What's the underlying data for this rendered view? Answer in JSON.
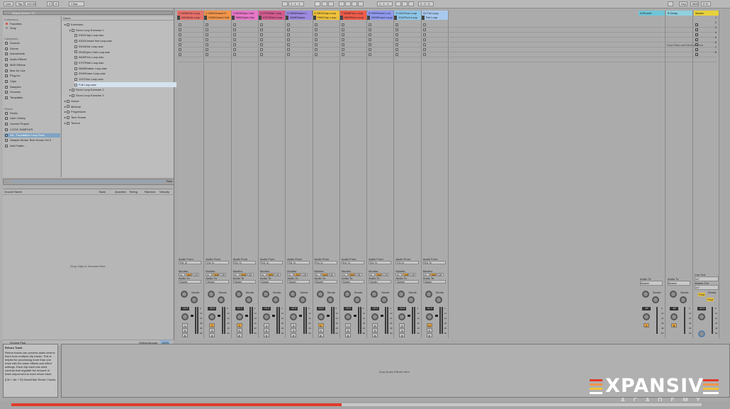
{
  "topbar": {
    "link": "Link",
    "tap": "Tap",
    "tempo": "120.00",
    "sig_num": "4",
    "sig_den": "4",
    "quantize": "1 Bar",
    "position": "1 . 1 . 1",
    "loop_start": "1 . 1 . 1",
    "loop_length": "4 . 0 . 0",
    "key": "Key",
    "midi": "MIDI",
    "cpu": "0 %"
  },
  "browser": {
    "search_placeholder": "Search (Cmd + F)",
    "collections_header": "Collections",
    "categories_header": "Categories",
    "places_header": "Places",
    "collections": [
      {
        "label": "Favorites",
        "color": "#d84a3a"
      },
      {
        "label": "Gray",
        "color": "#888888"
      }
    ],
    "categories": [
      "Sounds",
      "Drums",
      "Instruments",
      "Audio Effects",
      "MIDI Effects",
      "Max for Live",
      "Plug-ins",
      "Clips",
      "Samples",
      "Grooves",
      "Templates"
    ],
    "places": [
      "Packs",
      "User Library",
      "Current Project",
      "LOGIC SAMPLES",
      "XA - Foundation Loop Pack",
      "Sample Works Tech House Vol.3",
      "Add Folder..."
    ],
    "selected_place": "XA - Foundation Loop Pack",
    "name_header": "Name",
    "files": [
      {
        "label": "Exercises",
        "level": 0,
        "type": "folder"
      },
      {
        "label": "Drum Loop Exercise 1",
        "level": 1,
        "type": "folder"
      },
      {
        "label": "0302Clap Loop.wav",
        "level": 2,
        "type": "file"
      },
      {
        "label": "0303Closed Hat Loop.wav",
        "level": 2,
        "type": "file"
      },
      {
        "label": "0404Kick Loop.wav",
        "level": 2,
        "type": "file"
      },
      {
        "label": "0505Open Hat Loop.wav",
        "level": 2,
        "type": "file"
      },
      {
        "label": "0606Perc Loop.wav",
        "level": 2,
        "type": "file"
      },
      {
        "label": "0707Ride Loop.wav",
        "level": 2,
        "type": "file"
      },
      {
        "label": "0808Shaker Loop.wav",
        "level": 2,
        "type": "file"
      },
      {
        "label": "0909Snare Loop.wav",
        "level": 2,
        "type": "file"
      },
      {
        "label": "1010Tom Loop.wav",
        "level": 2,
        "type": "file"
      },
      {
        "label": "Full Loop.wav",
        "level": 2,
        "type": "file"
      },
      {
        "label": "Drum Loop Exercise 2",
        "level": 1,
        "type": "folder"
      },
      {
        "label": "Drum Loop Exercise 3",
        "level": 1,
        "type": "folder"
      },
      {
        "label": "House",
        "level": 0,
        "type": "folder"
      },
      {
        "label": "Minimal",
        "level": 0,
        "type": "folder"
      },
      {
        "label": "Progressive",
        "level": 0,
        "type": "folder"
      },
      {
        "label": "Tech House",
        "level": 0,
        "type": "folder"
      },
      {
        "label": "Techno",
        "level": 0,
        "type": "folder"
      }
    ],
    "selected_file": "Full Loop.wav",
    "raw_label": "Raw"
  },
  "groove": {
    "headers": [
      "Groove Name",
      "Base",
      "Quantize",
      "Timing",
      "Random",
      "Velocity"
    ],
    "drop_text": "Drop Clips or Grooves Here",
    "pool_label": "Groove Pool",
    "global_amount_label": "Global Amount",
    "global_amount_value": "100%"
  },
  "tracks": [
    {
      "name": "1 0404Kick Loop",
      "clip": "0404Kick Loop",
      "color": "#e8706a",
      "num": "1",
      "vol": "-14.3"
    },
    {
      "name": "2 0303Closed H",
      "clip": "0303Closed Hat",
      "color": "#f2954a",
      "num": "2",
      "vol": "-10.0"
    },
    {
      "name": "3 0505Open Hat",
      "clip": "0505Open Hat",
      "color": "#e877c9",
      "num": "3",
      "vol": "-11.3"
    },
    {
      "name": "4 0707Ride Loop",
      "clip": "0707Ride Loop",
      "color": "#d45b8f",
      "num": "4",
      "vol": "-10.3"
    },
    {
      "name": "5 0808Shaker L",
      "clip": "0808Shaker",
      "color": "#9c8ae0",
      "num": "5",
      "vol": "-12.4"
    },
    {
      "name": "6 0302Clap Loop",
      "clip": "0302Clap Loop",
      "color": "#f0c23a",
      "num": "6",
      "vol": "-14.3"
    },
    {
      "name": "7 0606Perc Loop",
      "clip": "0606Perc Loop",
      "color": "#ef5b4a",
      "num": "7",
      "vol": "-14.0"
    },
    {
      "name": "8 0909Snare Loo",
      "clip": "0909Snare Loop",
      "color": "#8f9af0",
      "num": "8",
      "vol": "-12.2"
    },
    {
      "name": "9 1010Tom Loop",
      "clip": "1010Tom Loop",
      "color": "#8ec6e8",
      "num": "9",
      "vol": "-10.4"
    },
    {
      "name": "10 Full Loop",
      "clip": "Full Loop",
      "color": "#a8c9ee",
      "num": "10",
      "vol": "-11.0"
    }
  ],
  "returns": [
    {
      "name": "A Reverb",
      "color": "#6fc5d8",
      "num": "A",
      "vol": "-inf"
    },
    {
      "name": "B Delay",
      "color": "#8fd0e0",
      "num": "B",
      "vol": "-inf"
    }
  ],
  "master": {
    "name": "Master",
    "color": "#e8d23a",
    "vol": "-12.3",
    "cue_label": "Cue Out",
    "cue_value": "1/2",
    "master_out_label": "Master Out",
    "master_out_value": "1/2",
    "post_label": "Post"
  },
  "session": {
    "drop_devices_text": "Drop Files and Devices Here",
    "audio_from_label": "Audio From",
    "ext_in": "Ext. In",
    "monitor_label": "Monitor",
    "monitor_options": [
      "In",
      "Auto",
      "Off"
    ],
    "audio_to_label": "Audio To",
    "audio_to_value": "Master",
    "sends_label": "Sends",
    "scene_numbers": [
      "1",
      "2",
      "3",
      "4",
      "5",
      "6",
      "7",
      "8"
    ],
    "db_marks": [
      "0",
      "12",
      "24",
      "36",
      "48",
      "60"
    ]
  },
  "info": {
    "title": "Return Track",
    "body": "Return tracks can process audio sent to them from multiple clip tracks. This is helpful for processing more than one track with the same effects and effect settings. Each clip track has send controls that regulate the amount of track output sent to each return track.",
    "shortcut": "[Ctrl + Alt + R] Show/Hide Return Tracks"
  },
  "devices": {
    "drop_text": "Drop Audio Effects Here"
  },
  "logo": {
    "word": "XPANSIV",
    "sub": "ACADEMY",
    "stripe_colors": [
      "#e23a2a",
      "#f2954a",
      "#f0c23a",
      "#ffffff"
    ]
  },
  "scroll": {
    "progress": 0.47,
    "color": "#e23a2a"
  }
}
